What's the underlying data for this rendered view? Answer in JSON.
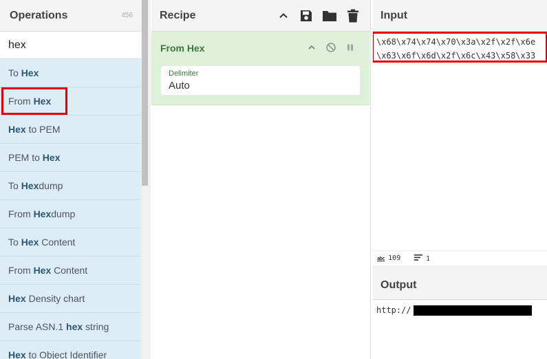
{
  "operations": {
    "title": "Operations",
    "count": "456",
    "search_value": "hex",
    "items": [
      {
        "pre": "To ",
        "match": "Hex",
        "post": ""
      },
      {
        "pre": "From ",
        "match": "Hex",
        "post": ""
      },
      {
        "pre": "",
        "match": "Hex",
        "post": " to PEM"
      },
      {
        "pre": "PEM to ",
        "match": "Hex",
        "post": ""
      },
      {
        "pre": "To ",
        "match": "Hex",
        "post": "dump"
      },
      {
        "pre": "From ",
        "match": "Hex",
        "post": "dump"
      },
      {
        "pre": "To ",
        "match": "Hex",
        "post": " Content"
      },
      {
        "pre": "From ",
        "match": "Hex",
        "post": " Content"
      },
      {
        "pre": "",
        "match": "Hex",
        "post": " Density chart"
      },
      {
        "pre": "Parse ASN.1 ",
        "match": "hex",
        "post": " string"
      },
      {
        "pre": "",
        "match": "Hex",
        "post": " to Object Identifier"
      }
    ]
  },
  "recipe": {
    "title": "Recipe",
    "icons": [
      "chevron-up-icon",
      "save-icon",
      "folder-icon",
      "trash-icon"
    ],
    "operation": {
      "name": "From Hex",
      "arg_label": "Delimiter",
      "arg_value": "Auto"
    }
  },
  "input": {
    "title": "Input",
    "line1": "\\x68\\x74\\x74\\x70\\x3a\\x2f\\x2f\\x6e",
    "line2": "\\x63\\x6f\\x6d\\x2f\\x6c\\x43\\x58\\x33"
  },
  "status": {
    "length_icon": "abc",
    "length": "109",
    "lines": "1"
  },
  "output": {
    "title": "Output",
    "text": "http://"
  },
  "colors": {
    "accent_red": "#e00000",
    "op_list_bg": "#dcedf6",
    "recipe_card_bg": "#dff0d8"
  }
}
